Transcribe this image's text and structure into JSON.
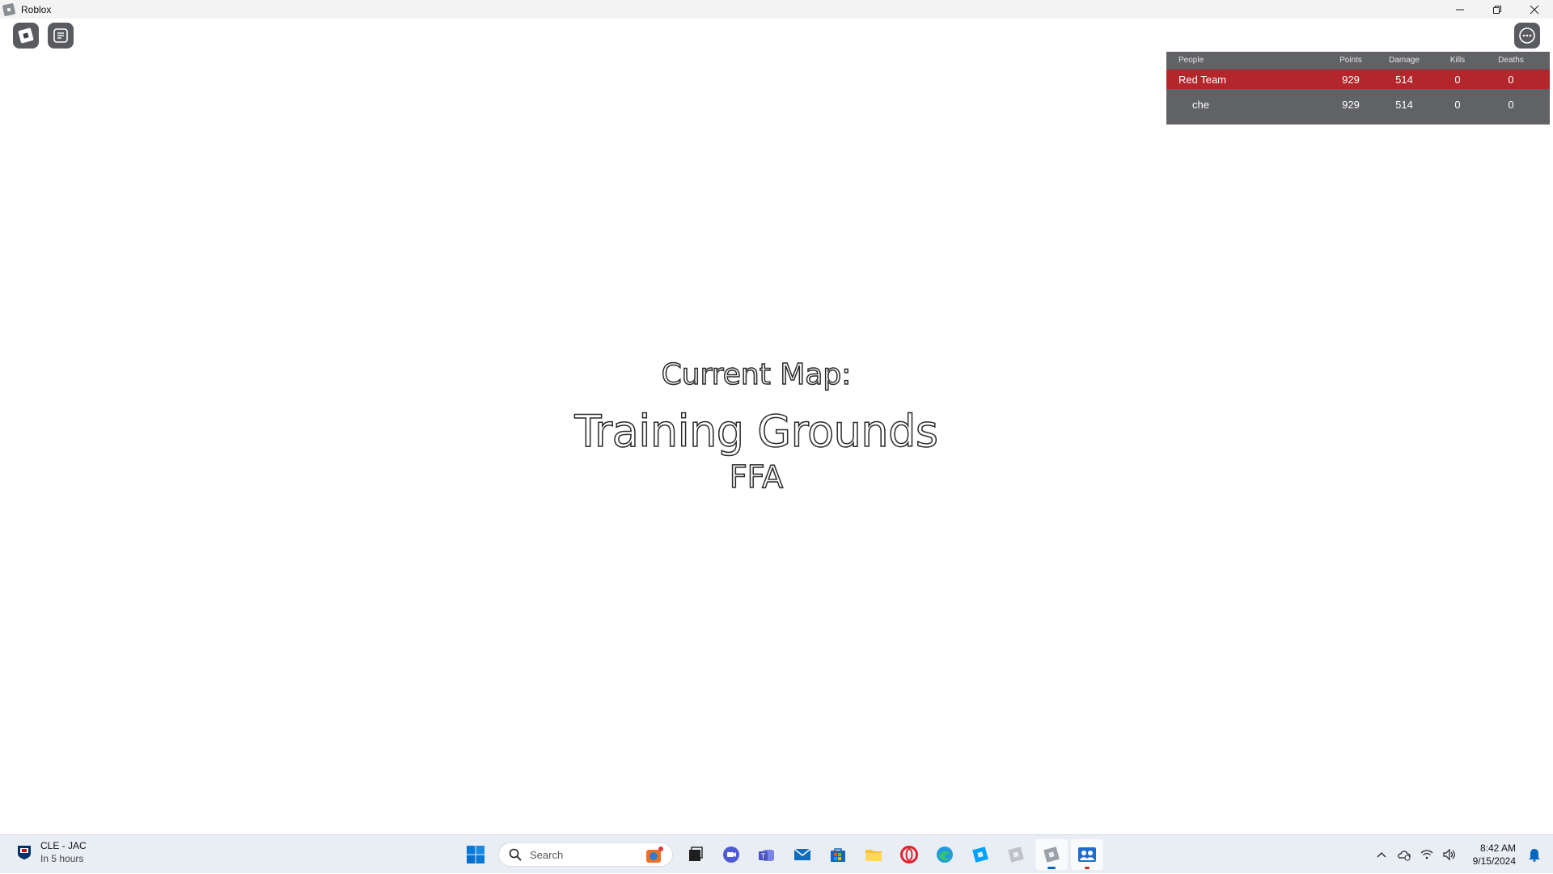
{
  "window": {
    "title": "Roblox",
    "controls": {
      "minimize": "─",
      "restore": "❐",
      "close": "✕"
    }
  },
  "leaderboard": {
    "headers": [
      "People",
      "Points",
      "Damage",
      "Kills",
      "Deaths"
    ],
    "team": {
      "name": "Red Team",
      "points": "929",
      "damage": "514",
      "kills": "0",
      "deaths": "0",
      "color": "#b3262b"
    },
    "players": [
      {
        "name": "che",
        "points": "929",
        "damage": "514",
        "kills": "0",
        "deaths": "0"
      }
    ]
  },
  "map": {
    "label": "Current Map:",
    "name": "Training Grounds",
    "mode": "FFA"
  },
  "taskbar": {
    "news": {
      "line1": "CLE - JAC",
      "line2": "In 5 hours"
    },
    "search_placeholder": "Search",
    "apps": [
      "windows-start-icon",
      "task-view-icon",
      "meet-icon",
      "teams-icon",
      "mail-icon",
      "store-icon",
      "file-explorer-icon",
      "opera-icon",
      "edge-icon",
      "roblox-studio-icon",
      "roblox-app-icon",
      "roblox-player-icon",
      "photos-icon"
    ],
    "clock": {
      "time": "8:42 AM",
      "date": "9/15/2024"
    },
    "accent": "#0067c0"
  }
}
